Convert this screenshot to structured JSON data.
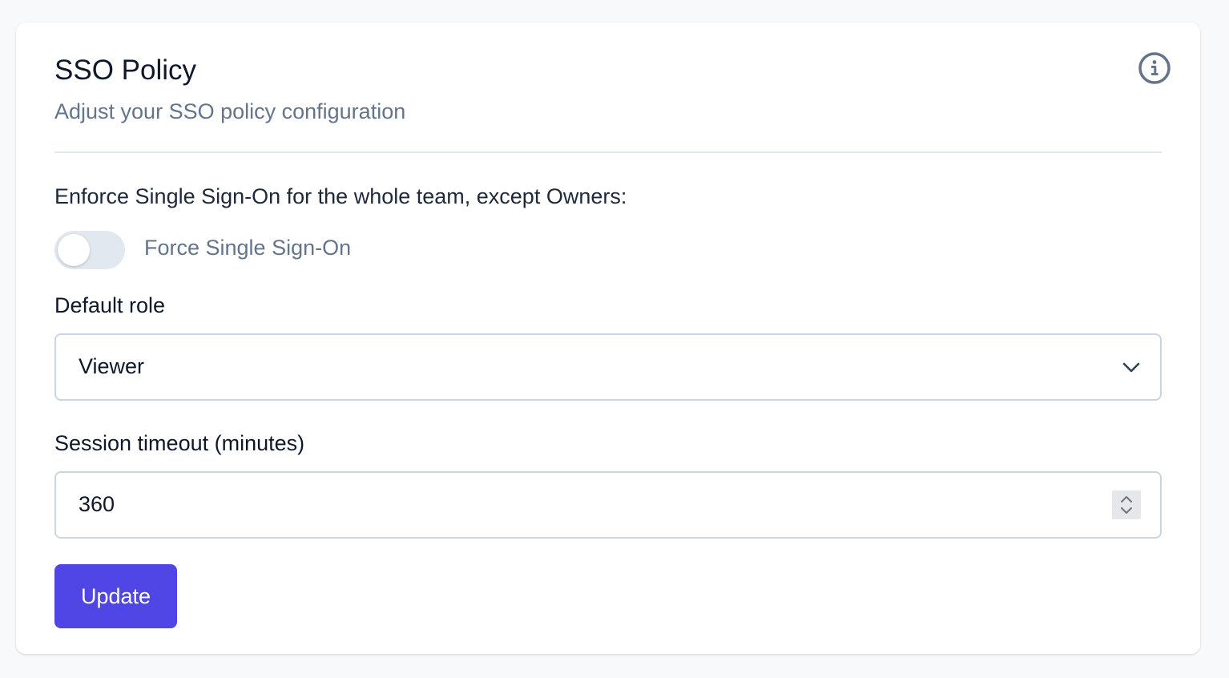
{
  "header": {
    "title": "SSO Policy",
    "subtitle": "Adjust your SSO policy configuration",
    "info_icon": "info-icon"
  },
  "enforce": {
    "label": "Enforce Single Sign-On for the whole team, except Owners:",
    "toggle_label": "Force Single Sign-On",
    "toggle_on": false
  },
  "default_role": {
    "label": "Default role",
    "selected": "Viewer"
  },
  "session_timeout": {
    "label": "Session timeout (minutes)",
    "value": "360"
  },
  "actions": {
    "update_label": "Update"
  },
  "colors": {
    "accent": "#4f46e5",
    "title": "#0f172a",
    "muted": "#64748b",
    "border": "#cbd5e1",
    "toggle_off": "#e2e8f0",
    "background": "#f8f9fb"
  }
}
